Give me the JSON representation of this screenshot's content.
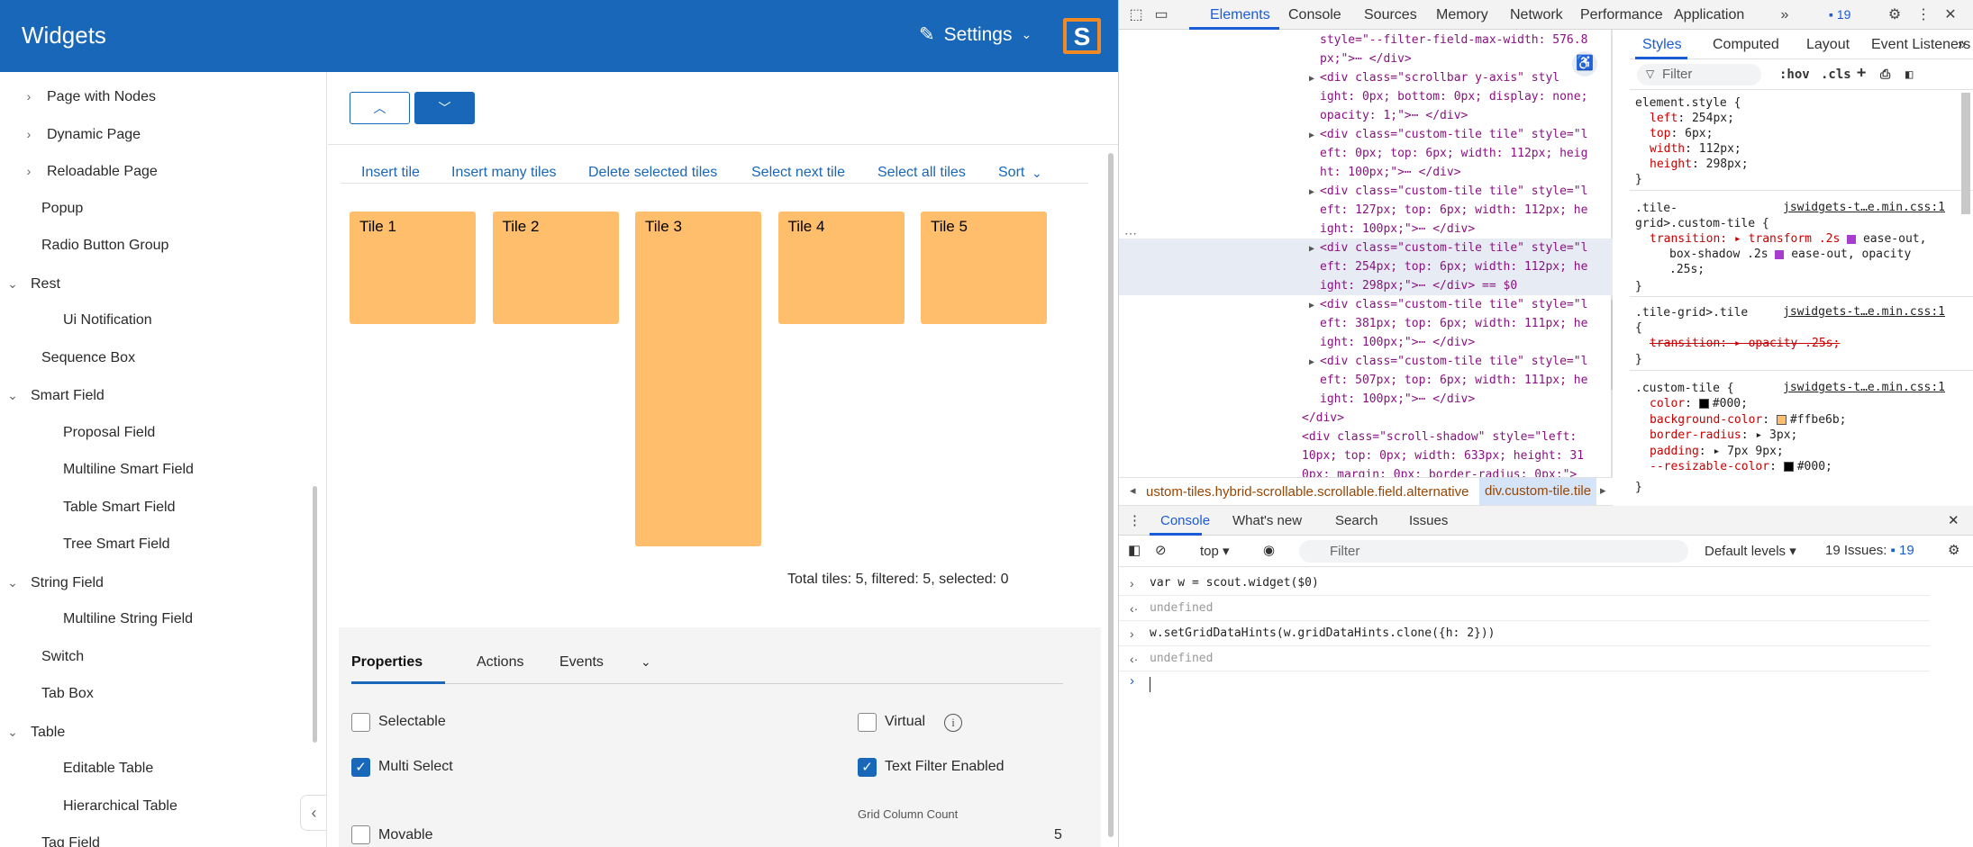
{
  "app": {
    "title": "Widgets",
    "settings_label": "Settings",
    "logo_letter": "S"
  },
  "nav": {
    "items": [
      {
        "label": "Page with Nodes",
        "chevron": "›"
      },
      {
        "label": "Dynamic Page",
        "chevron": "›"
      },
      {
        "label": "Reloadable Page",
        "chevron": "›"
      },
      {
        "label": "Popup"
      },
      {
        "label": "Radio Button Group"
      },
      {
        "label": "Rest",
        "chevron": "⌄"
      },
      {
        "label": "Ui Notification"
      },
      {
        "label": "Sequence Box"
      },
      {
        "label": "Smart Field",
        "chevron": "⌄"
      },
      {
        "label": "Proposal Field"
      },
      {
        "label": "Multiline Smart Field"
      },
      {
        "label": "Table Smart Field"
      },
      {
        "label": "Tree Smart Field"
      },
      {
        "label": "String Field",
        "chevron": "⌄"
      },
      {
        "label": "Multiline String Field"
      },
      {
        "label": "Switch"
      },
      {
        "label": "Tab Box"
      },
      {
        "label": "Table",
        "chevron": "⌄"
      },
      {
        "label": "Editable Table"
      },
      {
        "label": "Hierarchical Table"
      },
      {
        "label": "Tag Field"
      }
    ]
  },
  "main": {
    "up_icon": "chevron-up-icon",
    "down_icon": "chevron-down-icon",
    "menu": [
      "Insert tile",
      "Insert many tiles",
      "Delete selected tiles",
      "Select next tile",
      "Select all tiles",
      "Sort"
    ],
    "tiles": [
      "Tile 1",
      "Tile 2",
      "Tile 3",
      "Tile 4",
      "Tile 5"
    ],
    "tile_color": "#ffbe6b",
    "total_text": "Total tiles: 5, filtered: 5, selected: 0"
  },
  "properties": {
    "tabs": [
      "Properties",
      "Actions",
      "Events"
    ],
    "selectable_label": "Selectable",
    "virtual_label": "Virtual",
    "multi_select_label": "Multi Select",
    "text_filter_label": "Text Filter Enabled",
    "grid_column_count_label": "Grid Column Count",
    "grid_column_count_value": "5",
    "movable_label": "Movable"
  },
  "devtools": {
    "tabs": [
      "Elements",
      "Console",
      "Sources",
      "Memory",
      "Network",
      "Performance",
      "Application"
    ],
    "issues_count": "19",
    "elements_lines": [
      {
        "indent": 0,
        "html": "style=\"--filter-field-max-width: 576.8"
      },
      {
        "indent": 0,
        "html": "px;\">⋯ </div>"
      },
      {
        "indent": 1,
        "tri": true,
        "html": "<div class=\"scrollbar y-axis\" styl"
      },
      {
        "indent": 0,
        "html": "ight: 0px; bottom: 0px; display: none;"
      },
      {
        "indent": 0,
        "html": "opacity: 1;\">⋯ </div>"
      },
      {
        "indent": 1,
        "tri": true,
        "html": "<div class=\"custom-tile tile\" style=\"l"
      },
      {
        "indent": 0,
        "html": "eft: 0px; top: 6px; width: 112px; heig"
      },
      {
        "indent": 0,
        "html": "ht: 100px;\">⋯ </div>"
      },
      {
        "indent": 1,
        "tri": true,
        "html": "<div class=\"custom-tile tile\" style=\"l"
      },
      {
        "indent": 0,
        "html": "eft: 127px; top: 6px; width: 112px; he"
      },
      {
        "indent": 0,
        "html": "ight: 100px;\">⋯ </div>"
      },
      {
        "indent": 1,
        "tri": true,
        "sel": true,
        "html": "<div class=\"custom-tile tile\" style=\"l"
      },
      {
        "indent": 0,
        "sel": true,
        "html": "eft: 254px; top: 6px; width: 112px; he"
      },
      {
        "indent": 0,
        "sel": true,
        "html": "ight: 298px;\">⋯ </div> == $0"
      },
      {
        "indent": 1,
        "tri": true,
        "html": "<div class=\"custom-tile tile\" style=\"l"
      },
      {
        "indent": 0,
        "html": "eft: 381px; top: 6px; width: 111px; he"
      },
      {
        "indent": 0,
        "html": "ight: 100px;\">⋯ </div>"
      },
      {
        "indent": 1,
        "tri": true,
        "html": "<div class=\"custom-tile tile\" style=\"l"
      },
      {
        "indent": 0,
        "html": "eft: 507px; top: 6px; width: 111px; he"
      },
      {
        "indent": 0,
        "html": "ight: 100px;\">⋯ </div>"
      },
      {
        "indent": 0,
        "html": "</div>"
      },
      {
        "indent": 0,
        "html": "<div class=\"scroll-shadow\" style=\"left:"
      },
      {
        "indent": 0,
        "html": "10px; top: 0px; width: 633px; height: 31"
      },
      {
        "indent": 0,
        "html": "0px; margin: 0px; border-radius: 0px;\">"
      }
    ],
    "breadcrumb_left": "ustom-tiles.hybrid-scrollable.scrollable.field.alternative",
    "breadcrumb_right": "div.custom-tile.tile",
    "styles_tabs": [
      "Styles",
      "Computed",
      "Layout",
      "Event Listeners"
    ],
    "styles_filter_placeholder": "Filter",
    "hov": ":hov",
    "cls": ".cls",
    "element_style": {
      "selector": "element.style {",
      "props": [
        {
          "name": "left",
          "value": "254px;"
        },
        {
          "name": "top",
          "value": "6px;"
        },
        {
          "name": "width",
          "value": "112px;"
        },
        {
          "name": "height",
          "value": "298px;"
        }
      ]
    },
    "rule_source": "jswidgets-t…e.min.css:1",
    "rule1_selector_a": ".tile-",
    "rule1_selector_b": "grid>.custom-tile {",
    "rule1_transition": "transition: ▸ transform .2s",
    "rule1_easing": "ease-out,",
    "rule1_line2": "box-shadow .2s",
    "rule1_easing2": "ease-out, opacity",
    "rule1_line3": ".25s;",
    "rule2_selector": ".tile-grid>.tile",
    "rule2_transition": "transition: ▸ opacity .25s;",
    "rule3_selector": ".custom-tile {",
    "rule3_props": [
      {
        "name": "color",
        "value": "#000;",
        "swatch": "#000000"
      },
      {
        "name": "background-color",
        "value": "#ffbe6b;",
        "swatch": "#ffbe6b"
      },
      {
        "name": "border-radius",
        "value": "▸ 3px;"
      },
      {
        "name": "padding",
        "value": "▸ 7px 9px;"
      },
      {
        "name": "--resizable-color",
        "value": "#000;",
        "swatch": "#000000"
      }
    ],
    "drawer_tabs": [
      "Console",
      "What's new",
      "Search",
      "Issues"
    ],
    "context": "top",
    "console_filter_placeholder": "Filter",
    "levels": "Default levels",
    "issues_text": "19 Issues:",
    "console_lines": [
      {
        "type": "in",
        "text": "var w = scout.widget($0)"
      },
      {
        "type": "out",
        "text": "undefined"
      },
      {
        "type": "in",
        "text": "w.setGridDataHints(w.gridDataHints.clone({h: 2}))"
      },
      {
        "type": "out",
        "text": "undefined"
      }
    ]
  }
}
